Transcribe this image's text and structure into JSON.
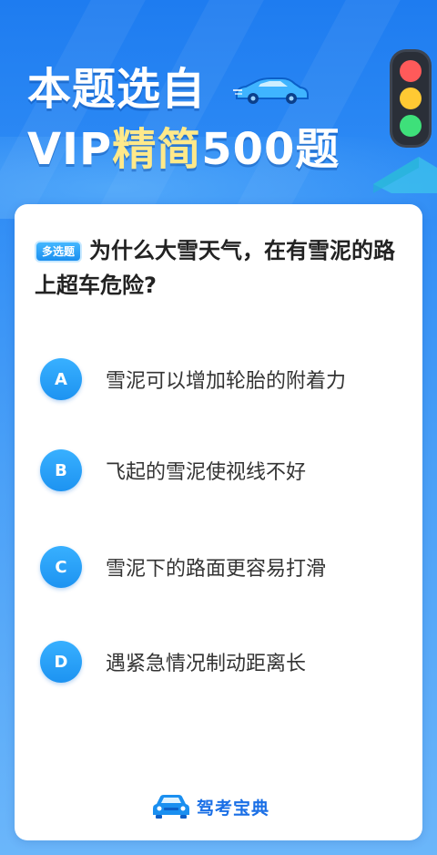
{
  "header": {
    "title_line1": "本题选自",
    "title_line2_prefix": "VIP",
    "title_line2_highlight": "精简",
    "title_line2_suffix": "500题"
  },
  "question": {
    "type_badge": "多选题",
    "text": "为什么大雪天气，在有雪泥的路上超车危险?"
  },
  "options": [
    {
      "letter": "A",
      "text": "雪泥可以增加轮胎的附着力"
    },
    {
      "letter": "B",
      "text": "飞起的雪泥使视线不好"
    },
    {
      "letter": "C",
      "text": "雪泥下的路面更容易打滑"
    },
    {
      "letter": "D",
      "text": "遇紧急情况制动距离长"
    }
  ],
  "brand": {
    "name": "驾考宝典",
    "icon": "car-logo-icon"
  },
  "colors": {
    "accent": "#1d93f1",
    "highlight": "#ffe98a",
    "brand": "#1a6fe6"
  }
}
